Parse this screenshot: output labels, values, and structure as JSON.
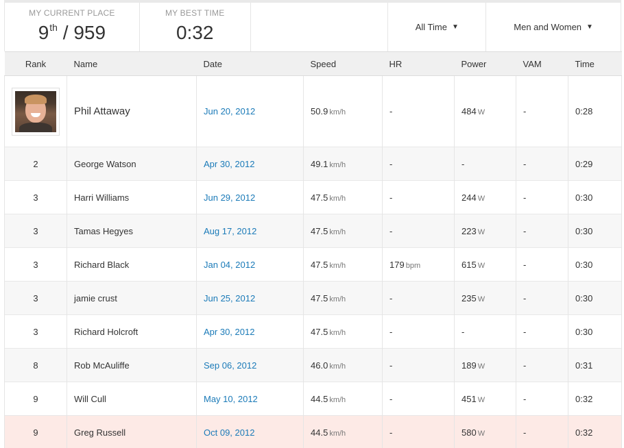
{
  "summary": {
    "place_label": "MY CURRENT PLACE",
    "place_value": "9",
    "place_suffix": "th",
    "place_total": "/ 959",
    "best_label": "MY BEST TIME",
    "best_value": "0:32"
  },
  "filters": {
    "time": "All Time",
    "gender": "Men and Women",
    "caret": "▼"
  },
  "columns": [
    "Rank",
    "Name",
    "Date",
    "Speed",
    "HR",
    "Power",
    "VAM",
    "Time"
  ],
  "units": {
    "speed": "km/h",
    "hr": "bpm",
    "power": "W"
  },
  "leader": {
    "name": "Phil Attaway",
    "date": "Jun 20, 2012",
    "speed": "50.9",
    "hr": "-",
    "power": "484",
    "vam": "-",
    "time": "0:28"
  },
  "rows": [
    {
      "rank": "2",
      "name": "George Watson",
      "date": "Apr 30, 2012",
      "speed": "49.1",
      "hr": "-",
      "power": "-",
      "vam": "-",
      "time": "0:29"
    },
    {
      "rank": "3",
      "name": "Harri Williams",
      "date": "Jun 29, 2012",
      "speed": "47.5",
      "hr": "-",
      "power": "244",
      "vam": "-",
      "time": "0:30"
    },
    {
      "rank": "3",
      "name": "Tamas Hegyes",
      "date": "Aug 17, 2012",
      "speed": "47.5",
      "hr": "-",
      "power": "223",
      "vam": "-",
      "time": "0:30"
    },
    {
      "rank": "3",
      "name": "Richard Black",
      "date": "Jan 04, 2012",
      "speed": "47.5",
      "hr": "179",
      "power": "615",
      "vam": "-",
      "time": "0:30"
    },
    {
      "rank": "3",
      "name": "jamie crust",
      "date": "Jun 25, 2012",
      "speed": "47.5",
      "hr": "-",
      "power": "235",
      "vam": "-",
      "time": "0:30"
    },
    {
      "rank": "3",
      "name": "Richard Holcroft",
      "date": "Apr 30, 2012",
      "speed": "47.5",
      "hr": "-",
      "power": "-",
      "vam": "-",
      "time": "0:30"
    },
    {
      "rank": "8",
      "name": "Rob McAuliffe",
      "date": "Sep 06, 2012",
      "speed": "46.0",
      "hr": "-",
      "power": "189",
      "vam": "-",
      "time": "0:31"
    },
    {
      "rank": "9",
      "name": "Will Cull",
      "date": "May 10, 2012",
      "speed": "44.5",
      "hr": "-",
      "power": "451",
      "vam": "-",
      "time": "0:32"
    },
    {
      "rank": "9",
      "name": "Greg Russell",
      "date": "Oct 09, 2012",
      "speed": "44.5",
      "hr": "-",
      "power": "580",
      "vam": "-",
      "time": "0:32"
    }
  ],
  "highlight_color": "#fdeae6",
  "link_color": "#1a7ab8"
}
